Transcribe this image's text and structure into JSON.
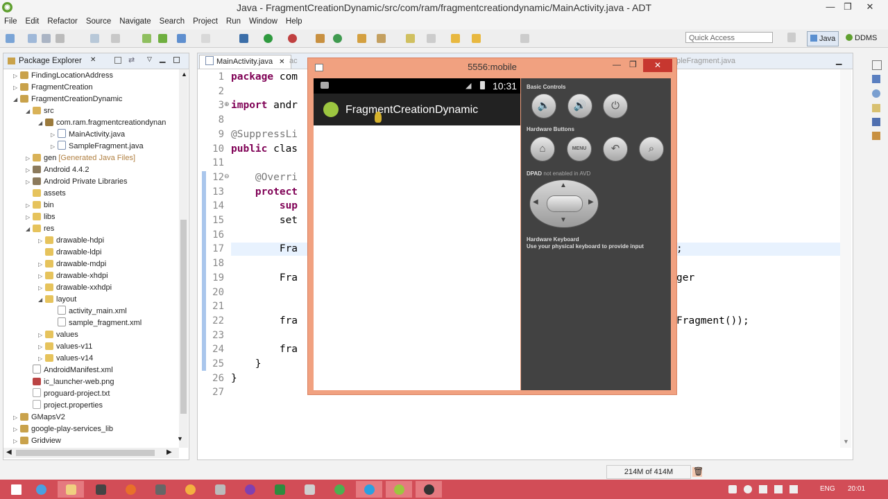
{
  "window": {
    "title": "Java - FragmentCreationDynamic/src/com/ram/fragmentcreationdynamic/MainActivity.java - ADT",
    "minimize": "—",
    "restore": "❐",
    "close": "✕"
  },
  "menu": [
    "File",
    "Edit",
    "Refactor",
    "Source",
    "Navigate",
    "Search",
    "Project",
    "Run",
    "Window",
    "Help"
  ],
  "toolbar": {
    "quick_access_placeholder": "Quick Access",
    "perspective_java": "Java",
    "perspective_ddms": "DDMS"
  },
  "package_explorer": {
    "title": "Package Explorer",
    "items": [
      {
        "label": "FindingLocationAddress",
        "indent": 0,
        "icon": "proj",
        "twisty": "▷"
      },
      {
        "label": "FragmentCreation",
        "indent": 0,
        "icon": "proj",
        "twisty": "▷"
      },
      {
        "label": "FragmentCreationDynamic",
        "indent": 0,
        "icon": "proj",
        "twisty": "◢"
      },
      {
        "label": "src",
        "indent": 1,
        "icon": "src",
        "twisty": "◢"
      },
      {
        "label": "com.ram.fragmentcreationdynan",
        "indent": 2,
        "icon": "pkgi",
        "twisty": "◢"
      },
      {
        "label": "MainActivity.java",
        "indent": 3,
        "icon": "java",
        "twisty": "▷"
      },
      {
        "label": "SampleFragment.java",
        "indent": 3,
        "icon": "java",
        "twisty": "▷"
      },
      {
        "label": "gen",
        "suffix": "[Generated Java Files]",
        "indent": 1,
        "icon": "src",
        "twisty": "▷"
      },
      {
        "label": "Android 4.4.2",
        "indent": 1,
        "icon": "lib",
        "twisty": "▷"
      },
      {
        "label": "Android Private Libraries",
        "indent": 1,
        "icon": "lib",
        "twisty": "▷"
      },
      {
        "label": "assets",
        "indent": 1,
        "icon": "folder",
        "twisty": ""
      },
      {
        "label": "bin",
        "indent": 1,
        "icon": "folder",
        "twisty": "▷"
      },
      {
        "label": "libs",
        "indent": 1,
        "icon": "folder",
        "twisty": "▷"
      },
      {
        "label": "res",
        "indent": 1,
        "icon": "folder",
        "twisty": "◢"
      },
      {
        "label": "drawable-hdpi",
        "indent": 2,
        "icon": "folder",
        "twisty": "▷"
      },
      {
        "label": "drawable-ldpi",
        "indent": 2,
        "icon": "folder",
        "twisty": ""
      },
      {
        "label": "drawable-mdpi",
        "indent": 2,
        "icon": "folder",
        "twisty": "▷"
      },
      {
        "label": "drawable-xhdpi",
        "indent": 2,
        "icon": "folder",
        "twisty": "▷"
      },
      {
        "label": "drawable-xxhdpi",
        "indent": 2,
        "icon": "folder",
        "twisty": "▷"
      },
      {
        "label": "layout",
        "indent": 2,
        "icon": "folder",
        "twisty": "◢"
      },
      {
        "label": "activity_main.xml",
        "indent": 3,
        "icon": "xml",
        "twisty": ""
      },
      {
        "label": "sample_fragment.xml",
        "indent": 3,
        "icon": "xml",
        "twisty": ""
      },
      {
        "label": "values",
        "indent": 2,
        "icon": "folder",
        "twisty": "▷"
      },
      {
        "label": "values-v11",
        "indent": 2,
        "icon": "folder",
        "twisty": "▷"
      },
      {
        "label": "values-v14",
        "indent": 2,
        "icon": "folder",
        "twisty": "▷"
      },
      {
        "label": "AndroidManifest.xml",
        "indent": 1,
        "icon": "xml",
        "twisty": ""
      },
      {
        "label": "ic_launcher-web.png",
        "indent": 1,
        "icon": "png",
        "twisty": ""
      },
      {
        "label": "proguard-project.txt",
        "indent": 1,
        "icon": "file",
        "twisty": ""
      },
      {
        "label": "project.properties",
        "indent": 1,
        "icon": "file",
        "twisty": ""
      },
      {
        "label": "GMapsV2",
        "indent": 0,
        "icon": "proj",
        "twisty": "▷"
      },
      {
        "label": "google-play-services_lib",
        "indent": 0,
        "icon": "proj",
        "twisty": "▷"
      },
      {
        "label": "Gridview",
        "indent": 0,
        "icon": "proj",
        "twisty": "▷"
      }
    ]
  },
  "editor": {
    "tab_main": "MainActivity.java",
    "tab_hidden_left": "ac",
    "tab_hidden_right": "pleFragment.java",
    "lines": [
      {
        "n": "1",
        "k": "package",
        "t": " com"
      },
      {
        "n": "2",
        "k": "",
        "t": ""
      },
      {
        "n": "3",
        "mark": "⊕",
        "k": "import",
        "t": " andr"
      },
      {
        "n": "8",
        "k": "",
        "t": ""
      },
      {
        "n": "9",
        "k": "",
        "a": "@SuppressLi",
        "t": ""
      },
      {
        "n": "10",
        "k": "public",
        "t": " clas"
      },
      {
        "n": "11",
        "k": "",
        "t": ""
      },
      {
        "n": "12",
        "mark": "⊖",
        "k": "",
        "a": "    @Overri",
        "t": ""
      },
      {
        "n": "13",
        "k": "    protect",
        "t": ""
      },
      {
        "n": "14",
        "k": "        sup",
        "t": ""
      },
      {
        "n": "15",
        "k": "",
        "t": "        set"
      },
      {
        "n": "16",
        "k": "",
        "t": ""
      },
      {
        "n": "17",
        "k": "",
        "t": "        Fra",
        "tail": ";"
      },
      {
        "n": "18",
        "k": "",
        "t": ""
      },
      {
        "n": "19",
        "k": "",
        "t": "        Fra",
        "tail": "ger"
      },
      {
        "n": "20",
        "k": "",
        "t": ""
      },
      {
        "n": "21",
        "k": "",
        "t": ""
      },
      {
        "n": "22",
        "k": "",
        "t": "        fra",
        "tail": "Fragment());"
      },
      {
        "n": "23",
        "k": "",
        "t": ""
      },
      {
        "n": "24",
        "k": "",
        "t": "        fra"
      },
      {
        "n": "25",
        "k": "",
        "t": "    }"
      },
      {
        "n": "26",
        "k": "",
        "t": "}"
      },
      {
        "n": "27",
        "k": "",
        "t": ""
      }
    ]
  },
  "emulator": {
    "title": "5556:mobile",
    "time": "10:31",
    "app_title": "FragmentCreationDynamic",
    "basic_controls": "Basic Controls",
    "hardware_buttons": "Hardware Buttons",
    "dpad_label": "DPAD",
    "dpad_note": "not enabled in AVD",
    "keyboard_title": "Hardware Keyboard",
    "keyboard_note": "Use your physical keyboard to provide input",
    "menu_label": "MENU"
  },
  "status": {
    "memory": "214M of 414M"
  },
  "taskbar": {
    "lang": "ENG",
    "clock": "20:01"
  },
  "colors": {
    "taskbar": "#d24d57",
    "emulator_frame": "#f1a180",
    "keyword": "#7f0055"
  }
}
